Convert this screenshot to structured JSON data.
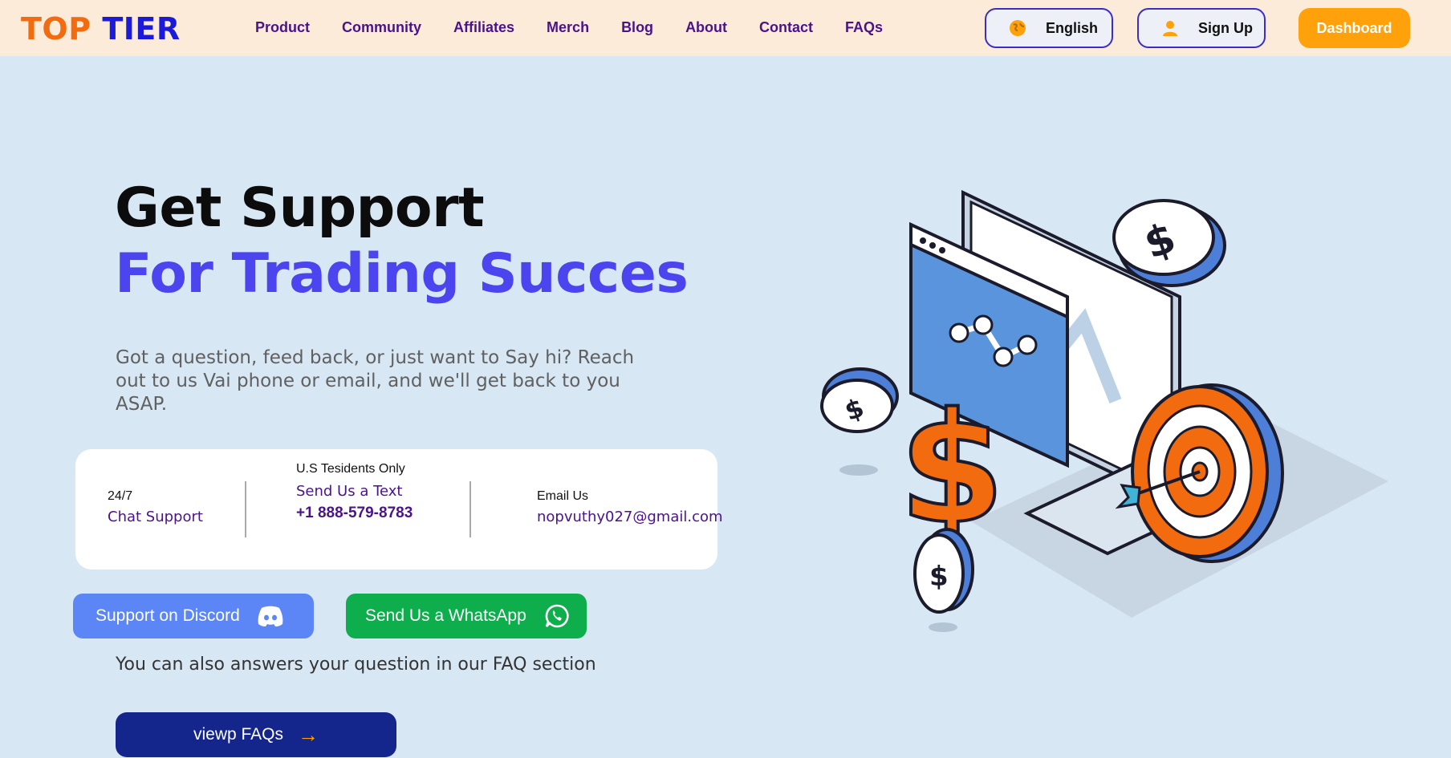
{
  "header": {
    "logo_part1": "TOP",
    "logo_part2": "TIER",
    "nav": [
      "Product",
      "Community",
      "Affiliates",
      "Merch",
      "Blog",
      "About",
      "Contact",
      "FAQs"
    ],
    "language_label": "English",
    "signup_label": "Sign Up",
    "dashboard_label": "Dashboard"
  },
  "hero": {
    "title_line1": "Get Support",
    "title_line2": "For Trading Succes",
    "lead": "Got a question, feed back, or just want to Say hi? Reach out to us Vai phone or email, and we'll get back to you ASAP."
  },
  "contact": {
    "chat_small": "24/7",
    "chat_label": "Chat Support",
    "text_small": "U.S Tesidents Only",
    "text_label": "Send Us a Text",
    "phone": "+1 888-579-8783",
    "email_small": "Email Us",
    "email": "nopvuthy027@gmail.com"
  },
  "actions": {
    "discord_label": "Support on Discord",
    "whatsapp_label": "Send Us a WhatsApp",
    "faq_note": "You can also answers your question in our FAQ section",
    "faq_button": "viewp FAQs",
    "faq_arrow": "→"
  },
  "icons": {
    "language": "globe-icon",
    "signup": "user-icon",
    "discord": "discord-icon",
    "whatsapp": "whatsapp-icon",
    "faq": "arrow-right-icon"
  },
  "colors": {
    "accent_purple": "#4b44ef",
    "nav_purple": "#4a138c",
    "orange": "#ffa10a",
    "discord": "#5c86f5",
    "whatsapp": "#0fae4c",
    "faq_button": "#14268c"
  }
}
